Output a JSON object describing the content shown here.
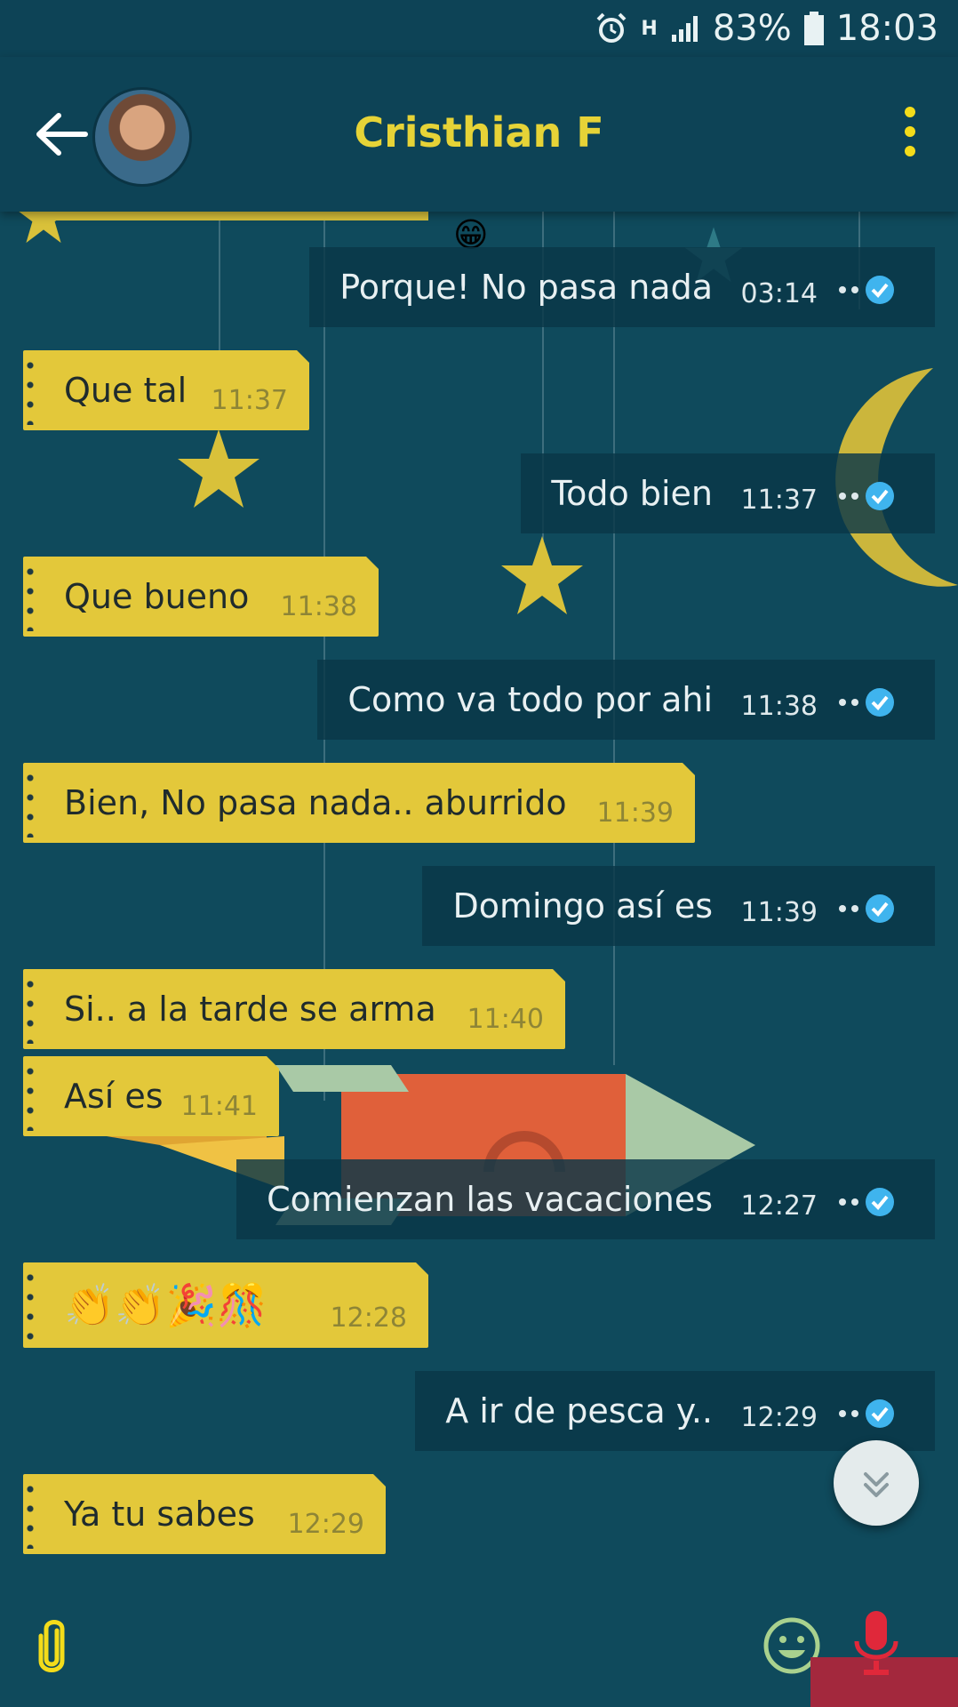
{
  "status_bar": {
    "alarm_icon": "alarm-clock-icon",
    "network_label": "H",
    "signal_icon": "cell-signal-icon",
    "battery_percent": "83%",
    "time": "18:03"
  },
  "header": {
    "contact_name": "Cristhian F",
    "back_icon": "arrow-left-icon",
    "menu_icon": "vertical-dots-icon"
  },
  "messages": [
    {
      "direction": "out",
      "text": "Porque! No pasa nada",
      "time": "03:14",
      "emoji_above": "😁"
    },
    {
      "direction": "in",
      "text": "Que tal",
      "time": "11:37"
    },
    {
      "direction": "out",
      "text": "Todo bien",
      "time": "11:37"
    },
    {
      "direction": "in",
      "text": "Que bueno",
      "time": "11:38"
    },
    {
      "direction": "out",
      "text": "Como va todo por ahi",
      "time": "11:38"
    },
    {
      "direction": "in",
      "text": "Bien, No pasa nada.. aburrido",
      "time": "11:39"
    },
    {
      "direction": "out",
      "text": "Domingo así es",
      "time": "11:39"
    },
    {
      "direction": "in",
      "text": "Si.. a la tarde se arma",
      "time": "11:40"
    },
    {
      "direction": "in",
      "text": "Así es",
      "time": "11:41"
    },
    {
      "direction": "out",
      "text": "Comienzan las vacaciones",
      "time": "12:27"
    },
    {
      "direction": "in",
      "text": "👏👏🎉🎊",
      "time": "12:28"
    },
    {
      "direction": "out",
      "text": "A ir de pesca y..",
      "time": "12:29"
    },
    {
      "direction": "in",
      "text": "Ya tu sabes",
      "time": "12:29"
    }
  ],
  "composer": {
    "attach_icon": "paperclip-icon",
    "emoji_icon": "smiley-icon",
    "mic_icon": "microphone-icon"
  },
  "scroll_down_icon": "double-chevron-down-icon",
  "colors": {
    "background": "#0f4a5c",
    "header": "#0d4356",
    "incoming_bubble": "#e3c83a",
    "outgoing_bubble": "#0a3748",
    "title": "#e6d337",
    "read_tick": "#3fb4ee"
  }
}
